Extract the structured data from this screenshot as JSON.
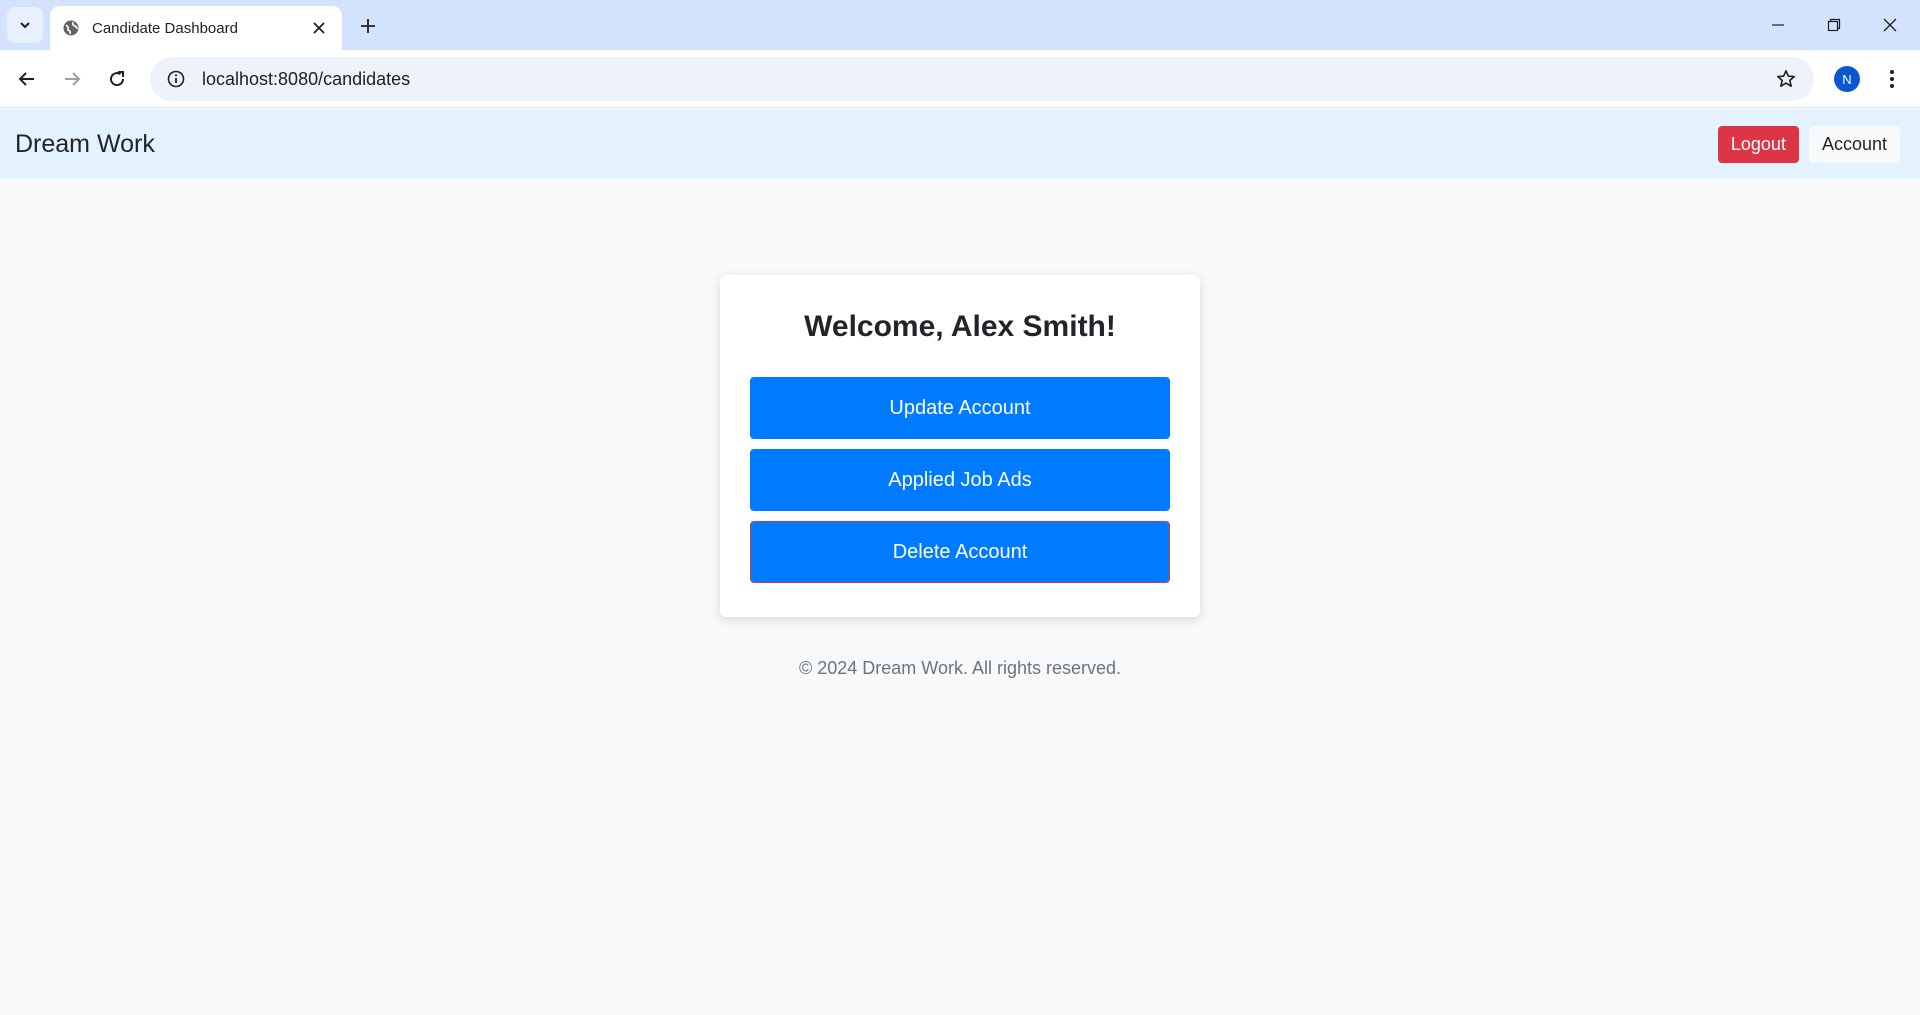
{
  "browser": {
    "tab_title": "Candidate Dashboard",
    "url": "localhost:8080/candidates",
    "profile_initial": "N"
  },
  "navbar": {
    "brand": "Dream Work",
    "logout_label": "Logout",
    "account_label": "Account",
    "colors": {
      "background": "#e3f2fd",
      "logout": "#dc3545"
    }
  },
  "card": {
    "welcome": "Welcome, Alex Smith!",
    "buttons": [
      {
        "label": "Update Account"
      },
      {
        "label": "Applied Job Ads"
      },
      {
        "label": "Delete Account"
      }
    ],
    "colors": {
      "primary": "#007bff",
      "danger_border": "#dc3545"
    }
  },
  "footer": {
    "text": "© 2024 Dream Work. All rights reserved."
  }
}
